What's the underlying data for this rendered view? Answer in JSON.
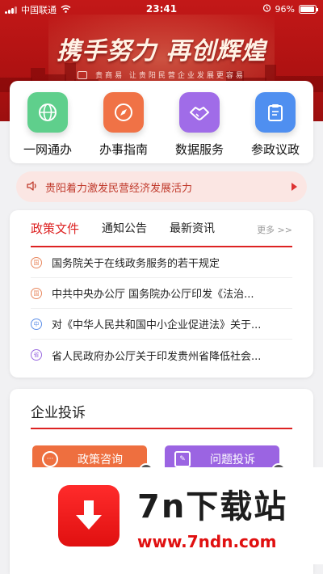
{
  "status_bar": {
    "carrier": "中国联通",
    "time": "23:41",
    "battery": "96%"
  },
  "banner": {
    "slogan": "携手努力 再创辉煌",
    "subline": "贵商易 让贵阳民营企业发展更容易"
  },
  "quick_links": [
    {
      "label": "一网通办",
      "color": "#5fcf8c"
    },
    {
      "label": "办事指南",
      "color": "#f07246"
    },
    {
      "label": "数据服务",
      "color": "#a06ce8"
    },
    {
      "label": "参政议政",
      "color": "#4f8ff0"
    }
  ],
  "notice": {
    "text": "贵阳着力激发民营经济发展活力"
  },
  "policy": {
    "tabs": [
      "政策文件",
      "通知公告",
      "最新资讯"
    ],
    "more": "更多 >>",
    "items": [
      {
        "text": "国务院关于在线政务服务的若干规定",
        "color": "#e8885f"
      },
      {
        "text": "中共中央办公厅 国务院办公厅印发《法治...",
        "color": "#e8885f"
      },
      {
        "text": "对《中华人民共和国中小企业促进法》关于...",
        "color": "#5d8fe8"
      },
      {
        "text": "省人民政府办公厅关于印发贵州省降低社会...",
        "color": "#9a6be0"
      }
    ]
  },
  "complaint": {
    "title": "企业投诉",
    "buttons": [
      {
        "label": "政策咨询",
        "color": "#ee6f3f"
      },
      {
        "label": "问题投诉",
        "color": "#9b64e2"
      }
    ]
  },
  "watermark": {
    "brand": "7n下载站",
    "url": "www.7ndn.com"
  }
}
